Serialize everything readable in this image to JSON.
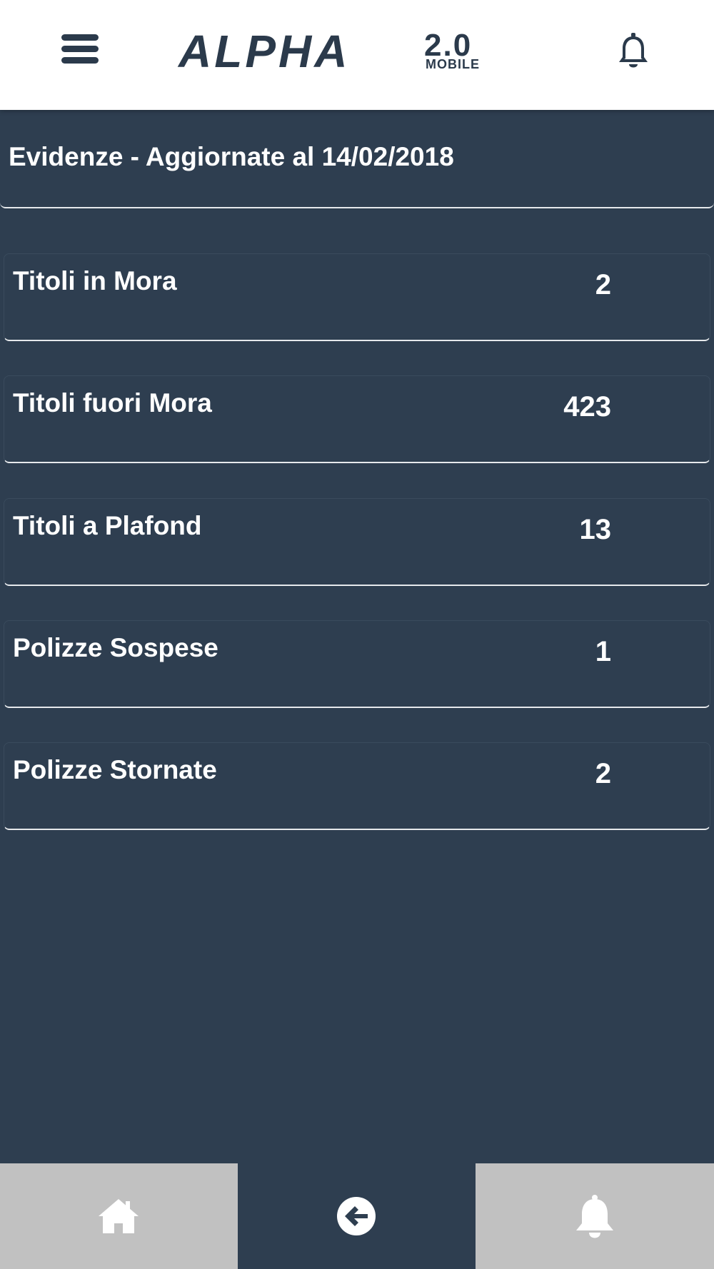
{
  "app": {
    "logo_main": "ALPHA",
    "logo_version": "2.0",
    "logo_sub": "MOBILE"
  },
  "header": {
    "title": "Evidenze - Aggiornate al 14/02/2018"
  },
  "rows": [
    {
      "label": "Titoli in Mora",
      "value": "2"
    },
    {
      "label": "Titoli fuori Mora",
      "value": "423"
    },
    {
      "label": "Titoli a Plafond",
      "value": "13"
    },
    {
      "label": "Polizze Sospese",
      "value": "1"
    },
    {
      "label": "Polizze Stornate",
      "value": "2"
    }
  ],
  "icons": {
    "menu": "hamburger-menu-icon",
    "notifications": "bell-icon",
    "home": "home-icon",
    "back": "arrow-left-circle-icon",
    "bottom_notifications": "bell-icon"
  },
  "colors": {
    "background": "#2e3e50",
    "topbar": "#ffffff",
    "brand": "#2b3a4b",
    "tab_inactive": "#c1c1c1",
    "text": "#ffffff"
  }
}
